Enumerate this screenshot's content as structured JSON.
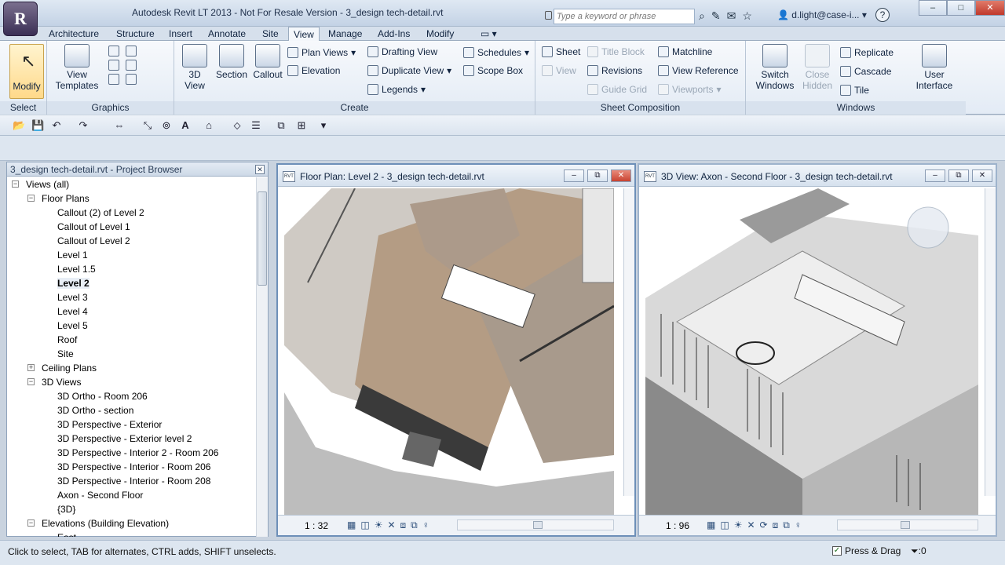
{
  "app": {
    "title": "Autodesk Revit LT 2013 - Not For Resale Version -    3_design tech-detail.rvt",
    "search_placeholder": "Type a keyword or phrase",
    "user": "d.light@case-i...",
    "help": "?",
    "logo_letter": "R",
    "min": "–",
    "max": "□",
    "close": "✕"
  },
  "tabs": [
    "Architecture",
    "Structure",
    "Insert",
    "Annotate",
    "Site",
    "View",
    "Manage",
    "Add-Ins",
    "Modify",
    "▭ ▾"
  ],
  "active_tab": "View",
  "ribbon": {
    "select": {
      "modify": "Modify",
      "title": "Select"
    },
    "graphics": {
      "view_templates": "View\nTemplates",
      "title": "Graphics"
    },
    "create": {
      "three_d_view": "3D\nView",
      "section": "Section",
      "callout": "Callout",
      "plan_views": "Plan Views",
      "elevation": "Elevation",
      "drafting_view": "Drafting  View",
      "duplicate_view": "Duplicate  View",
      "legends": "Legends",
      "schedules": "Schedules",
      "scope_box": "Scope  Box",
      "title": "Create"
    },
    "sheet_composition": {
      "sheet": "Sheet",
      "view": "View",
      "title_block": "Title  Block",
      "revisions": "Revisions",
      "guide_grid": "Guide  Grid",
      "matchline": "Matchline",
      "view_reference": "View  Reference",
      "viewports": "Viewports",
      "title": "Sheet Composition"
    },
    "windows": {
      "switch_windows": "Switch\nWindows",
      "close_hidden": "Close\nHidden",
      "replicate": "Replicate",
      "cascade": "Cascade",
      "tile": "Tile",
      "user_interface": "User\nInterface",
      "title": "Windows"
    }
  },
  "project_browser": {
    "title": "3_design tech-detail.rvt - Project Browser",
    "items": [
      {
        "label": "Views (all)",
        "level": 0,
        "exp": "−"
      },
      {
        "label": "Floor Plans",
        "level": 1,
        "exp": "−"
      },
      {
        "label": "Callout (2) of Level 2",
        "level": 2
      },
      {
        "label": "Callout of Level 1",
        "level": 2
      },
      {
        "label": "Callout of Level 2",
        "level": 2
      },
      {
        "label": "Level 1",
        "level": 2
      },
      {
        "label": "Level 1.5",
        "level": 2
      },
      {
        "label": "Level 2",
        "level": 2,
        "bold": true
      },
      {
        "label": "Level 3",
        "level": 2
      },
      {
        "label": "Level 4",
        "level": 2
      },
      {
        "label": "Level 5",
        "level": 2
      },
      {
        "label": "Roof",
        "level": 2
      },
      {
        "label": "Site",
        "level": 2
      },
      {
        "label": "Ceiling Plans",
        "level": 1,
        "exp": "+"
      },
      {
        "label": "3D Views",
        "level": 1,
        "exp": "−"
      },
      {
        "label": "3D Ortho - Room 206",
        "level": 2
      },
      {
        "label": "3D Ortho - section",
        "level": 2
      },
      {
        "label": "3D Perspective - Exterior",
        "level": 2
      },
      {
        "label": "3D Perspective - Exterior level 2",
        "level": 2
      },
      {
        "label": "3D Perspective - Interior 2 - Room 206",
        "level": 2
      },
      {
        "label": "3D Perspective - Interior - Room 206",
        "level": 2
      },
      {
        "label": "3D Perspective - Interior - Room 208",
        "level": 2
      },
      {
        "label": "Axon - Second Floor",
        "level": 2
      },
      {
        "label": "{3D}",
        "level": 2
      },
      {
        "label": "Elevations (Building Elevation)",
        "level": 1,
        "exp": "−"
      },
      {
        "label": "East",
        "level": 2
      }
    ]
  },
  "view1": {
    "title": "Floor Plan: Level 2 - 3_design tech-detail.rvt",
    "scale": "1 : 32",
    "rvt": "RVT"
  },
  "view2": {
    "title": "3D View: Axon - Second Floor - 3_design tech-detail.rvt",
    "scale": "1 : 96",
    "rvt": "RVT"
  },
  "status": {
    "text": "Click to select, TAB for alternates, CTRL adds, SHIFT unselects.",
    "press_drag": "Press & Drag",
    "filter": ":0",
    "check": "✓"
  }
}
